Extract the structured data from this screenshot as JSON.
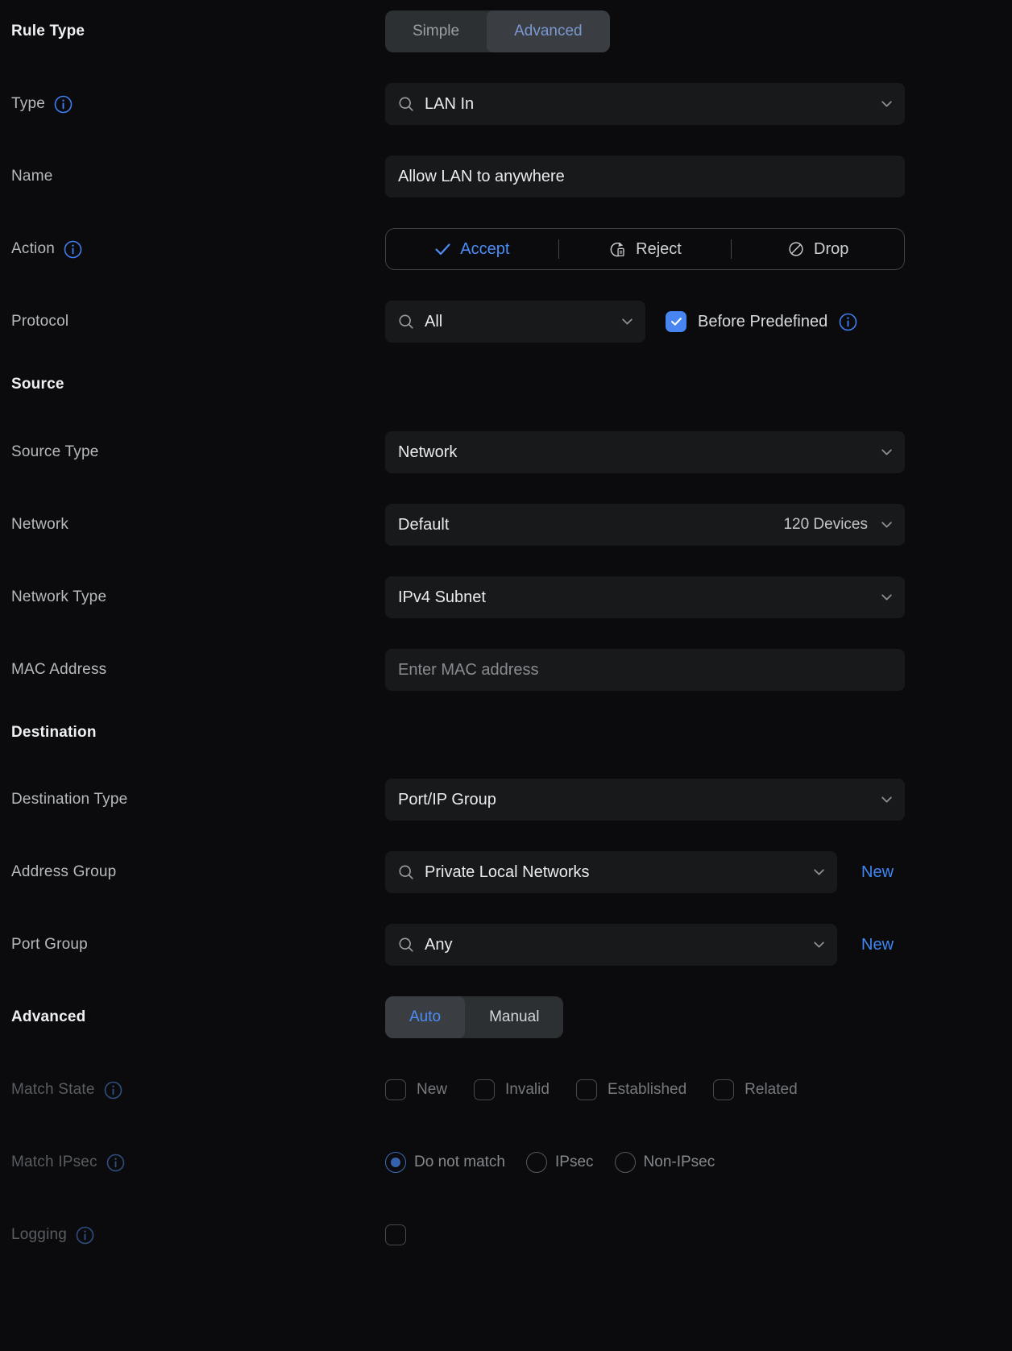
{
  "colors": {
    "accent_blue": "#4c8df6",
    "link_blue": "#3f86f4",
    "checkbox_checked_blue": "#4786f0",
    "field_background": "#18191b",
    "page_background": "#0b0b0d"
  },
  "form": {
    "rule_type": {
      "label": "Rule Type",
      "options": [
        "Simple",
        "Advanced"
      ],
      "selected": "Advanced"
    },
    "type": {
      "label": "Type",
      "value": "LAN In"
    },
    "name": {
      "label": "Name",
      "value": "Allow LAN to anywhere"
    },
    "action": {
      "label": "Action",
      "options": [
        "Accept",
        "Reject",
        "Drop"
      ],
      "selected": "Accept"
    },
    "protocol": {
      "label": "Protocol",
      "value": "All",
      "before_predefined_label": "Before Predefined",
      "before_predefined_checked": true
    },
    "source": {
      "heading": "Source",
      "source_type": {
        "label": "Source Type",
        "value": "Network"
      },
      "network": {
        "label": "Network",
        "value": "Default",
        "meta": "120 Devices"
      },
      "network_type": {
        "label": "Network Type",
        "value": "IPv4 Subnet"
      },
      "mac_address": {
        "label": "MAC Address",
        "placeholder": "Enter MAC address"
      }
    },
    "destination": {
      "heading": "Destination",
      "destination_type": {
        "label": "Destination Type",
        "value": "Port/IP Group"
      },
      "address_group": {
        "label": "Address Group",
        "value": "Private Local Networks",
        "new_label": "New"
      },
      "port_group": {
        "label": "Port Group",
        "value": "Any",
        "new_label": "New"
      }
    },
    "advanced": {
      "heading": "Advanced",
      "options": [
        "Auto",
        "Manual"
      ],
      "selected": "Auto",
      "match_state": {
        "label": "Match State",
        "options": [
          "New",
          "Invalid",
          "Established",
          "Related"
        ],
        "checked": []
      },
      "match_ipsec": {
        "label": "Match IPsec",
        "options": [
          "Do not match",
          "IPsec",
          "Non-IPsec"
        ],
        "selected": "Do not match"
      },
      "logging": {
        "label": "Logging",
        "checked": false
      }
    }
  }
}
